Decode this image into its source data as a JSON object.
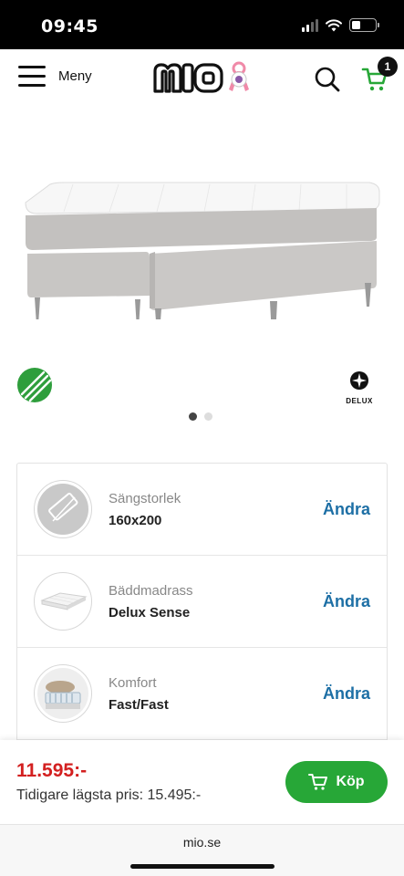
{
  "status_bar": {
    "time": "09:45",
    "battery_level": 0.3
  },
  "nav": {
    "menu_label": "Meny",
    "cart_count": "1",
    "logo_text": "mio"
  },
  "gallery": {
    "slides": 2,
    "active_slide": 1,
    "partner_logo": "DELUX"
  },
  "config": {
    "rows": [
      {
        "label": "Sängstorlek",
        "value": "160x200",
        "action": "Ändra",
        "icon": "bed-size-icon"
      },
      {
        "label": "Bäddmadrass",
        "value": "Delux Sense",
        "action": "Ändra",
        "icon": "mattress-topper-icon"
      },
      {
        "label": "Komfort",
        "value": "Fast/Fast",
        "action": "Ändra",
        "icon": "comfort-icon"
      }
    ]
  },
  "purchase": {
    "price": "11.595:-",
    "previous_price": "Tidigare lägsta pris: 15.495:-",
    "buy_label": "Köp"
  },
  "browser": {
    "url": "mio.se"
  },
  "colors": {
    "price_red": "#d32020",
    "buy_green": "#27a737",
    "link_blue": "#1d6fa5",
    "ribbon_pink": "#f08aa8"
  }
}
